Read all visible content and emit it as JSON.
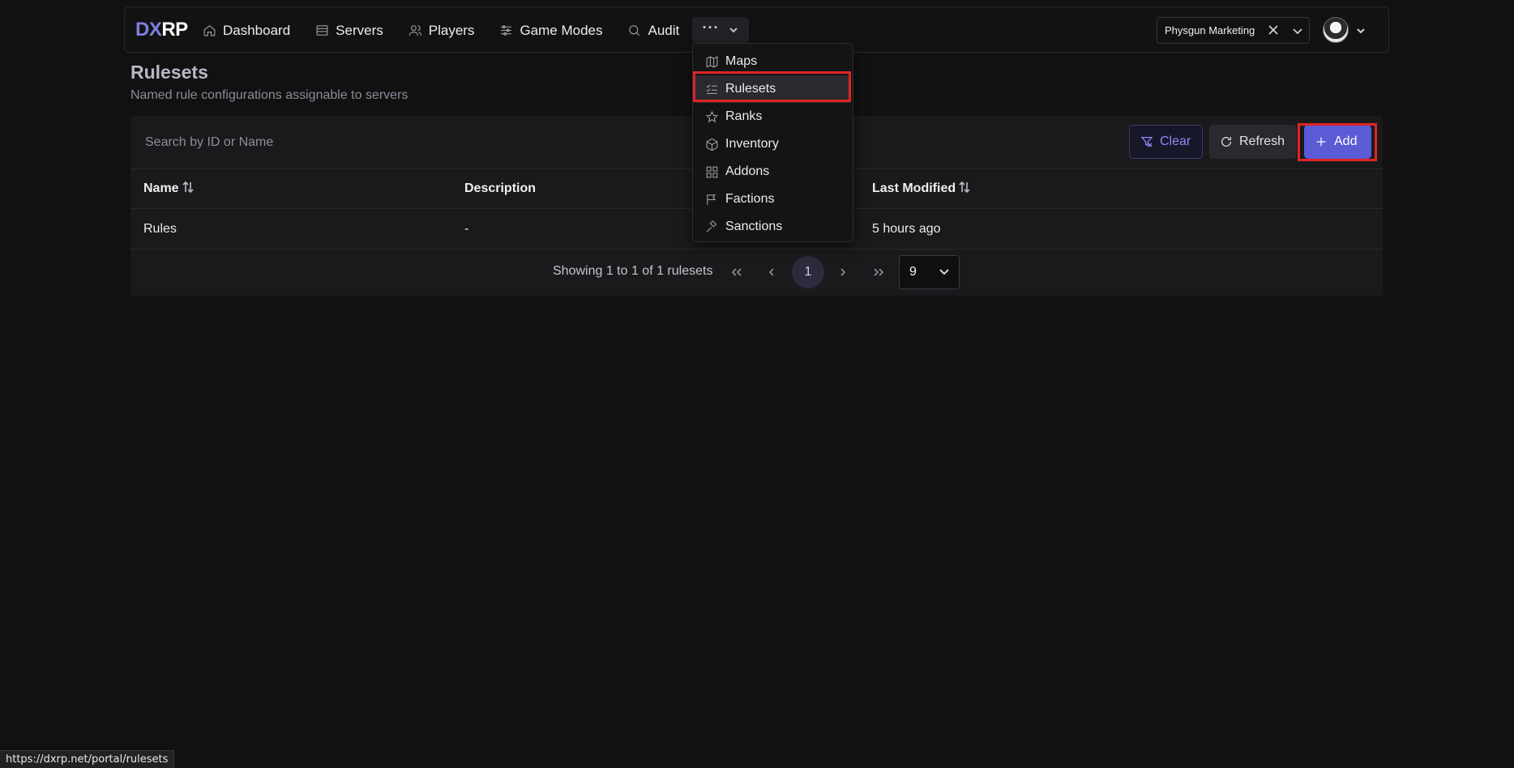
{
  "brand": {
    "part1": "DX",
    "part2": "RP"
  },
  "nav": {
    "items": [
      {
        "label": "Dashboard",
        "icon": "home-icon"
      },
      {
        "label": "Servers",
        "icon": "server-icon"
      },
      {
        "label": "Players",
        "icon": "users-icon"
      },
      {
        "label": "Game Modes",
        "icon": "sliders-icon"
      },
      {
        "label": "Audit",
        "icon": "search-icon"
      }
    ],
    "more_label": "···"
  },
  "org_selector": {
    "value": "Physgun Marketing"
  },
  "page": {
    "title": "Rulesets",
    "subtitle": "Named rule configurations assignable to servers"
  },
  "toolbar": {
    "search_placeholder": "Search by ID or Name",
    "clear_label": "Clear",
    "refresh_label": "Refresh",
    "add_label": "Add"
  },
  "table": {
    "columns": [
      "Name",
      "Description",
      "Last Modified"
    ],
    "rows": [
      {
        "name": "Rules",
        "description": "-",
        "last_modified": "5 hours ago"
      }
    ]
  },
  "pagination": {
    "summary": "Showing 1 to 1 of 1 rulesets",
    "current_page": "1",
    "page_size": "9"
  },
  "dropdown": {
    "items": [
      {
        "label": "Maps",
        "icon": "map-icon"
      },
      {
        "label": "Rulesets",
        "icon": "list-checks-icon",
        "active": true
      },
      {
        "label": "Ranks",
        "icon": "star-icon"
      },
      {
        "label": "Inventory",
        "icon": "box-icon"
      },
      {
        "label": "Addons",
        "icon": "grid-icon"
      },
      {
        "label": "Factions",
        "icon": "flag-icon"
      },
      {
        "label": "Sanctions",
        "icon": "gavel-icon"
      }
    ]
  },
  "status_url": "https://dxrp.net/portal/rulesets",
  "colors": {
    "accent": "#5b5bd6",
    "highlight": "#e02424",
    "background": "#111111"
  }
}
